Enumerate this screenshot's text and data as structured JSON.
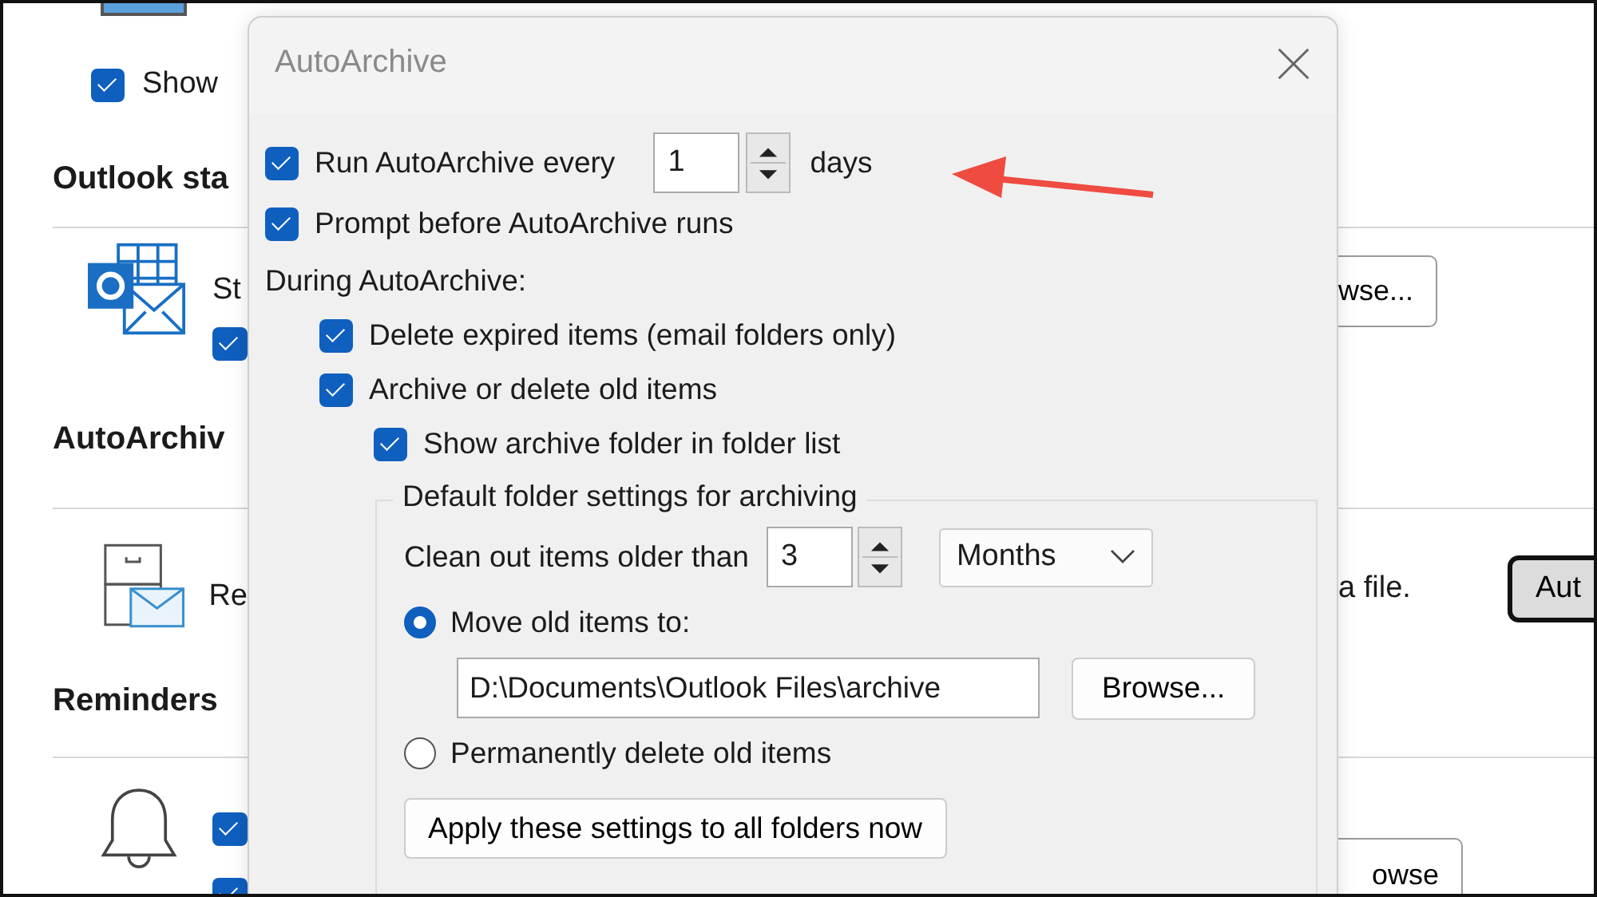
{
  "background": {
    "top_option": {
      "label": "Show",
      "checked": true
    },
    "sections": [
      {
        "heading": "Outlook sta",
        "kind": "data-file",
        "text": "St",
        "checkboxes": [
          {
            "checked": true
          }
        ]
      },
      {
        "heading": "AutoArchiv",
        "kind": "archive",
        "text": "Re"
      },
      {
        "heading": "Reminders",
        "kind": "bell",
        "checkboxes": [
          {
            "checked": true
          },
          {
            "checked": true
          }
        ]
      }
    ],
    "right": {
      "browse_button": "wse...",
      "note": "a file.",
      "autoarchive_button": "Aut",
      "bottom_button": "owse"
    }
  },
  "dialog": {
    "title": "AutoArchive",
    "run": {
      "label": "Run AutoArchive every",
      "checked": true,
      "value": "1",
      "unit": "days"
    },
    "prompt": {
      "label": "Prompt before AutoArchive runs",
      "checked": true
    },
    "during_label": "During AutoArchive:",
    "delete_expired": {
      "label": "Delete expired items (email folders only)",
      "checked": true
    },
    "archive_old": {
      "label": "Archive or delete old items",
      "checked": true
    },
    "show_folder": {
      "label": "Show archive folder in folder list",
      "checked": true
    },
    "group": {
      "legend": "Default folder settings for archiving",
      "clean_label": "Clean out items older than",
      "clean_value": "3",
      "period": "Months",
      "options": [
        {
          "label": "Move old items to:",
          "selected": true
        },
        {
          "label": "Permanently delete old items",
          "selected": false
        }
      ],
      "path": "D:\\Documents\\Outlook Files\\archive",
      "browse": "Browse...",
      "apply": "Apply these settings to all folders now"
    }
  }
}
